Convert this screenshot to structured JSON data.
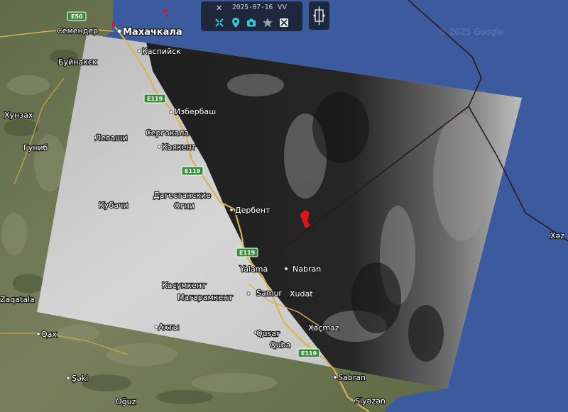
{
  "toolbar": {
    "close_label": "✕",
    "date": "2025-07-16",
    "polarization": "VV",
    "icons": [
      "crosshair-icon",
      "location-pin-icon",
      "camera-icon",
      "star-icon",
      "scissors-icon"
    ],
    "colors": {
      "background": "#1c2334",
      "icon": "#35c9d6",
      "star": "#9aa0aa"
    }
  },
  "side_button": {
    "icon": "split-compare-icon"
  },
  "map": {
    "copyright": "© 2025 Google",
    "cities": [
      {
        "id": "makhachkala",
        "name": "Махачкала"
      },
      {
        "id": "semender",
        "name": "Семендер"
      },
      {
        "id": "kaspiysk",
        "name": "Каспийск"
      },
      {
        "id": "buynaksk",
        "name": "Буйнакск"
      },
      {
        "id": "izberbash",
        "name": "Избербаш"
      },
      {
        "id": "khunzakh",
        "name": "Хунзах"
      },
      {
        "id": "levashi",
        "name": "Леваши"
      },
      {
        "id": "sergokala",
        "name": "Сергокала"
      },
      {
        "id": "gunib",
        "name": "Гуниб"
      },
      {
        "id": "kayakent",
        "name": "Каякент"
      },
      {
        "id": "dagogni1",
        "name": "Дагестанские"
      },
      {
        "id": "dagogni2",
        "name": "Огни"
      },
      {
        "id": "kubachi",
        "name": "Кубачи"
      },
      {
        "id": "derbent",
        "name": "Дербент"
      },
      {
        "id": "yalama",
        "name": "Yalama"
      },
      {
        "id": "nabran",
        "name": "Nabran"
      },
      {
        "id": "kasumkent",
        "name": "Касумкент"
      },
      {
        "id": "samur",
        "name": "Samur"
      },
      {
        "id": "khudat",
        "name": "Xudat"
      },
      {
        "id": "magaramkent",
        "name": "Магарамкент"
      },
      {
        "id": "zaqatala",
        "name": "Zaqatala"
      },
      {
        "id": "akhty",
        "name": "Ахты"
      },
      {
        "id": "qusar",
        "name": "Qusar"
      },
      {
        "id": "xachmaz",
        "name": "Xaçmaz"
      },
      {
        "id": "qax",
        "name": "Qax"
      },
      {
        "id": "quba",
        "name": "Quba"
      },
      {
        "id": "sheki",
        "name": "Şəki"
      },
      {
        "id": "sabran",
        "name": "Sabran"
      },
      {
        "id": "oguz",
        "name": "Oğuz"
      },
      {
        "id": "siyazan",
        "name": "Siyəzən"
      },
      {
        "id": "khaz",
        "name": "Xəz"
      }
    ],
    "road_shields": [
      {
        "id": "e50",
        "label": "E50"
      },
      {
        "id": "e119a",
        "label": "E119"
      },
      {
        "id": "e119b",
        "label": "E119"
      },
      {
        "id": "e119c",
        "label": "E119"
      },
      {
        "id": "e119d",
        "label": "E119"
      }
    ],
    "colors": {
      "sea": "#3b5b9e",
      "land": "#6b7a4e",
      "overlay_light": "#c9c9c9",
      "overlay_dark": "#202020",
      "road": "#d9b24a",
      "shield": "#3a8d3a",
      "boundary": "#2a1a1a",
      "marker": "#e01414"
    }
  }
}
